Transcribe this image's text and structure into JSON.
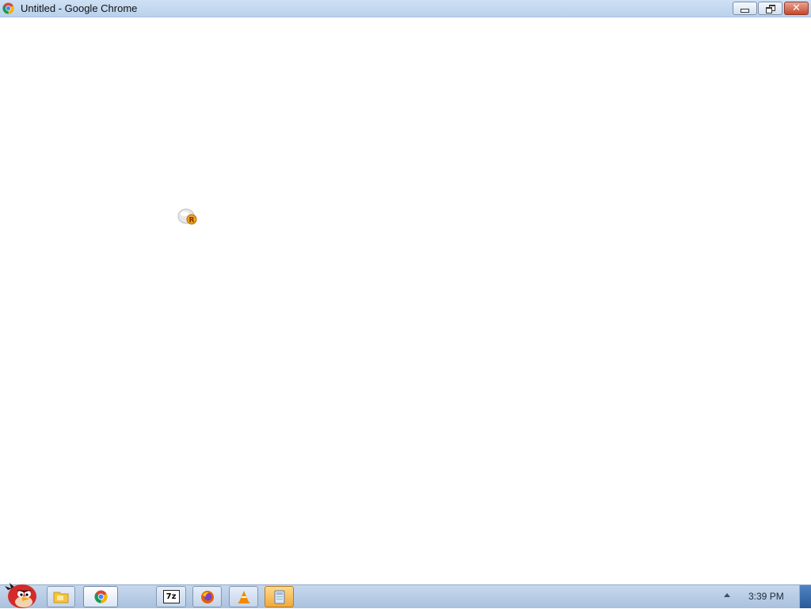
{
  "window": {
    "title": "Untitled - Google Chrome",
    "close_glyph": "✕"
  },
  "taskbar": {
    "clock": "3:39 PM",
    "items": [
      {
        "name": "windows-explorer",
        "icon": "folder-icon"
      },
      {
        "name": "google-chrome",
        "icon": "chrome-icon",
        "active": true
      },
      {
        "name": "7zip",
        "icon": "7zip-icon",
        "label": "7z"
      },
      {
        "name": "firefox",
        "icon": "firefox-icon"
      },
      {
        "name": "vlc",
        "icon": "vlc-cone-icon"
      },
      {
        "name": "app",
        "icon": "app-icon"
      }
    ]
  },
  "colors": {
    "titlebar": "#b9d1ec",
    "taskbar": "#a9c1de",
    "close_button": "#c7472c"
  }
}
